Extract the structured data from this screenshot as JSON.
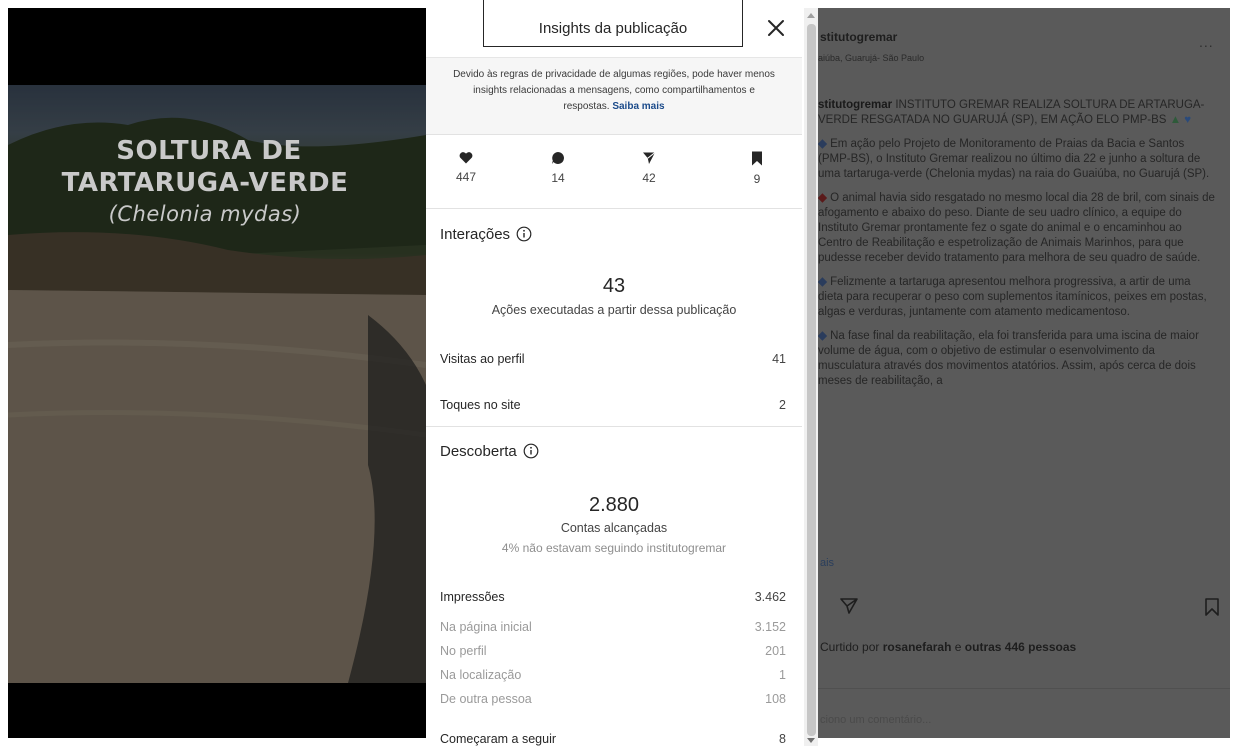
{
  "media": {
    "title_line1": "SOLTURA DE",
    "title_line2": "TARTARUGA-VERDE",
    "title_line3": "(Chelonia mydas)"
  },
  "modal": {
    "title": "Insights da publicação",
    "close_icon": "close-icon",
    "notice_text": "Devido às regras de privacidade de algumas regiões, pode haver menos insights relacionadas a mensagens, como compartilhamentos e respostas.",
    "notice_link": "Saiba mais",
    "stats": [
      {
        "icon": "heart-icon",
        "value": "447"
      },
      {
        "icon": "comment-icon",
        "value": "14"
      },
      {
        "icon": "send-icon",
        "value": "42"
      },
      {
        "icon": "bookmark-icon",
        "value": "9"
      }
    ],
    "interacoes": {
      "title": "Interações",
      "total": "43",
      "subtitle": "Ações executadas a partir dessa publicação",
      "rows": [
        {
          "label": "Visitas ao perfil",
          "value": "41"
        },
        {
          "label": "Toques no site",
          "value": "2"
        }
      ]
    },
    "descoberta": {
      "title": "Descoberta",
      "total": "2.880",
      "subtitle": "Contas alcançadas",
      "note": "4% não estavam seguindo institutogremar",
      "impressoes": {
        "label": "Impressões",
        "value": "3.462"
      },
      "breakdown": [
        {
          "label": "Na página inicial",
          "value": "3.152"
        },
        {
          "label": "No perfil",
          "value": "201"
        },
        {
          "label": "Na localização",
          "value": "1"
        },
        {
          "label": "De outra pessoa",
          "value": "108"
        }
      ],
      "seguir": {
        "label": "Começaram a seguir",
        "value": "8"
      }
    }
  },
  "post": {
    "username": "stitutogremar",
    "location": "aiúba, Guarujá- São Paulo",
    "more": "...",
    "caption_user": "stitutogremar",
    "caption_head": "INSTITUTO GREMAR REALIZA SOLTURA DE ARTARUGA-VERDE RESGATADA NO GUARUJÁ (SP), EM AÇÃO ELO PMP-BS",
    "p1": "Em ação pelo Projeto de Monitoramento de Praias da Bacia e Santos (PMP-BS), o Instituto Gremar realizou no último dia 22 e junho a soltura de uma tartaruga-verde (Chelonia mydas) na raia do Guaiúba, no Guarujá (SP).",
    "p2": "O animal havia sido resgatado no mesmo local dia 28 de bril, com sinais de afogamento e abaixo do peso. Diante de seu uadro clínico, a equipe do Instituto Gremar prontamente fez o sgate do animal e o encaminhou ao Centro de Reabilitação e espetrolização de Animais Marinhos, para que pudesse receber devido tratamento para melhora de seu quadro de saúde.",
    "p3": "Felizmente a tartaruga apresentou melhora progressiva, a artir de uma dieta para recuperar o peso com suplementos itamínicos, peixes em postas, algas e verduras, juntamente com atamento medicamentoso.",
    "p4": "Na fase final da reabilitação, ela foi transferida para uma iscina de maior volume de água, com o objetivo de estimular o esenvolvimento da musculatura através dos movimentos atatórios. Assim, após cerca de dois meses de reabilitação, a",
    "mais": "ais",
    "liked_prefix": "Curtido por",
    "liked_user": "rosanefarah",
    "liked_mid": "e",
    "liked_rest": "outras 446 pessoas",
    "comment_placeholder": "ciono um comentário..."
  },
  "colors": {
    "accent_link": "#1a4a8a",
    "muted": "#9a9a9a"
  }
}
